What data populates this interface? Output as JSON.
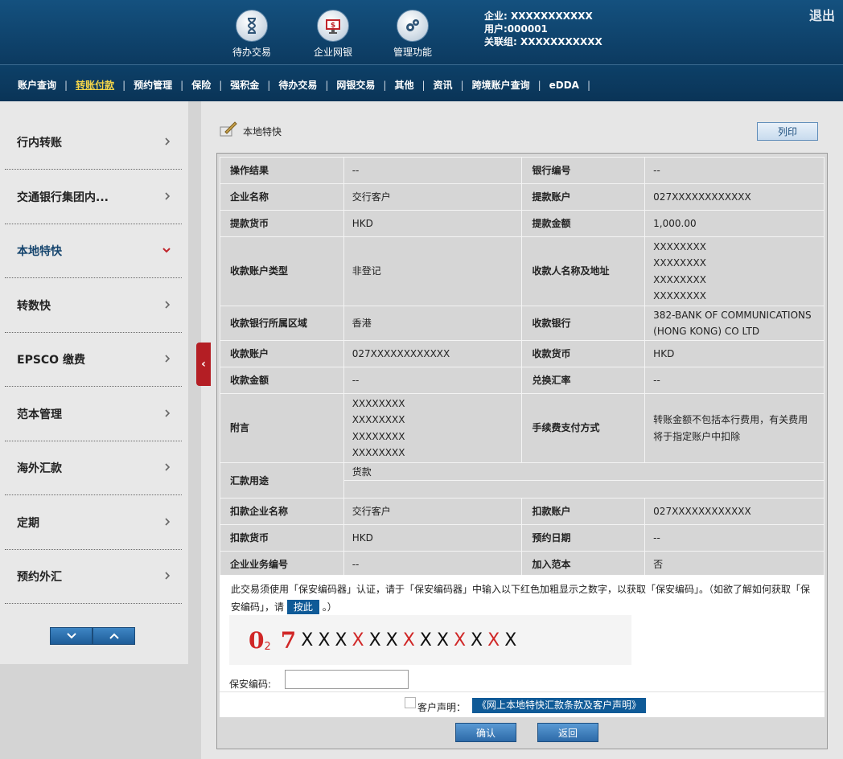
{
  "header": {
    "icons": [
      {
        "label": "待办交易",
        "icon": "hourglass-icon"
      },
      {
        "label": "企业网银",
        "icon": "monitor-dollar-icon"
      },
      {
        "label": "管理功能",
        "icon": "gears-icon"
      }
    ],
    "info": {
      "company": "企业: XXXXXXXXXXX",
      "user": "用户:000001",
      "group": "关联组: XXXXXXXXXXX"
    },
    "logout": "退出"
  },
  "nav": {
    "items": [
      "账户查询",
      "转账付款",
      "预约管理",
      "保险",
      "强积金",
      "待办交易",
      "网银交易",
      "其他",
      "资讯",
      "跨境账户查询",
      "eDDA"
    ],
    "active": "转账付款"
  },
  "sidebar": {
    "items": [
      "行内转账",
      "交通银行集团内...",
      "本地特快",
      "转数快",
      "EPSCO 缴费",
      "范本管理",
      "海外汇款",
      "定期",
      "预约外汇"
    ],
    "active": "本地特快"
  },
  "section": {
    "title": "本地特快",
    "print": "列印"
  },
  "details": {
    "rows": [
      [
        "操作结果",
        "--",
        "银行编号",
        "--"
      ],
      [
        "企业名称",
        "交行客户",
        "提款账户",
        "027XXXXXXXXXXXX"
      ],
      [
        "提款货币",
        "HKD",
        "提款金额",
        "1,000.00"
      ],
      [
        "收款账户类型",
        "非登记",
        "收款人名称及地址",
        "XXXXXXXX\nXXXXXXXX\nXXXXXXXX\nXXXXXXXX"
      ],
      [
        "收款银行所属区域",
        "香港",
        "收款银行",
        "382-BANK OF COMMUNICATIONS\n(HONG KONG) CO LTD"
      ],
      [
        "收款账户",
        "027XXXXXXXXXXXX",
        "收款货币",
        "HKD"
      ],
      [
        "收款金额",
        "--",
        "兑换汇率",
        "--"
      ],
      [
        "附言",
        "XXXXXXXX\nXXXXXXXX\nXXXXXXXX\nXXXXXXXX",
        "手续费支付方式",
        "转账金额不包括本行费用，有关费用\n将于指定账户中扣除"
      ]
    ],
    "purpose_label": "汇款用途",
    "purpose_value": "货款",
    "rows2": [
      [
        "扣款企业名称",
        "交行客户",
        "扣款账户",
        "027XXXXXXXXXXXX"
      ],
      [
        "扣款货币",
        "HKD",
        "预约日期",
        "--"
      ],
      [
        "企业业务编号",
        "--",
        "加入范本",
        "否"
      ]
    ]
  },
  "security": {
    "note_part1": "此交易须使用「保安编码器」认证，请于「保安编码器」中输入以下红色加粗显示之数字，以获取「保安编码」。（如欲了解如何获取「保安编码」，请",
    "here": "按此",
    "note_part2": "。）",
    "code_big1": "0",
    "code_sub": "2",
    "code_big2": "7",
    "code_chars": [
      "X",
      "X",
      "X",
      "X",
      "X",
      "X",
      "X",
      "X",
      "X",
      "X",
      "X",
      "X",
      "X"
    ],
    "code_red_index": [
      3,
      6,
      9,
      11
    ],
    "code_label": "保安编码:",
    "code_value": ""
  },
  "declaration": {
    "label": "客户声明：",
    "link": "《网上本地特快汇款条款及客户声明》"
  },
  "buttons": {
    "confirm": "确认",
    "back": "返回"
  },
  "colors": {
    "header_bg": "#0c3a60",
    "nav_active": "#f3d54a",
    "accent_red": "#b41e24",
    "link_blue": "#0f5a97"
  }
}
